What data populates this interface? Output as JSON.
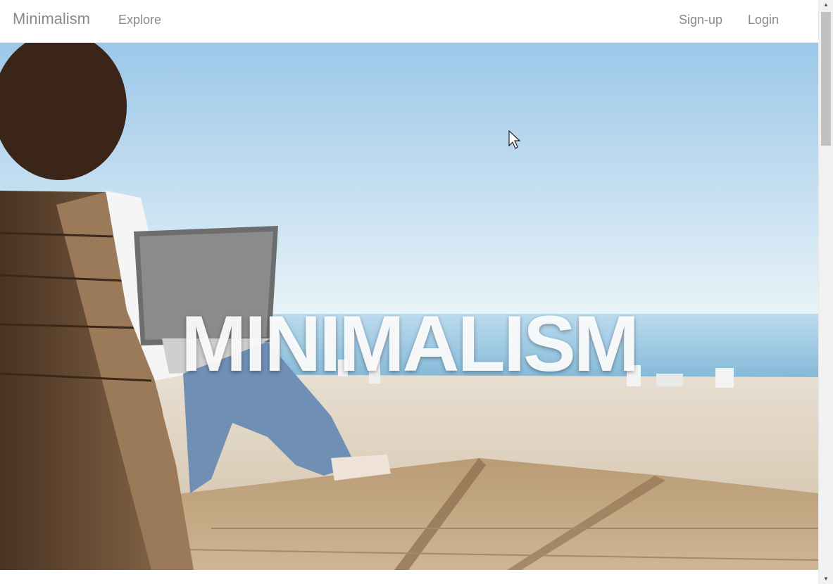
{
  "navbar": {
    "brand": "Minimalism",
    "links": {
      "explore": "Explore",
      "signup": "Sign-up",
      "login": "Login"
    }
  },
  "hero": {
    "title": "MINIMALISM",
    "image": "woman-with-laptop-on-beach-deck-chair"
  },
  "scrollbar": {
    "up_icon": "▲",
    "down_icon": "▼"
  },
  "colors": {
    "nav_text": "#8a8a8a",
    "hero_text": "#ffffff"
  }
}
